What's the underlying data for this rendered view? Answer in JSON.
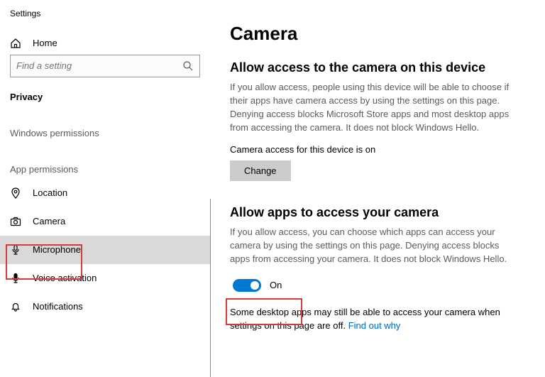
{
  "app_title": "Settings",
  "home_label": "Home",
  "search": {
    "placeholder": "Find a setting"
  },
  "category_label": "Privacy",
  "group_windows": "Windows permissions",
  "group_app": "App permissions",
  "sidebar": {
    "items": [
      {
        "label": "Location"
      },
      {
        "label": "Camera"
      },
      {
        "label": "Microphone"
      },
      {
        "label": "Voice activation"
      },
      {
        "label": "Notifications"
      }
    ]
  },
  "page": {
    "title": "Camera",
    "s1_title": "Allow access to the camera on this device",
    "s1_desc": "If you allow access, people using this device will be able to choose if their apps have camera access by using the settings on this page. Denying access blocks Microsoft Store apps and most desktop apps from accessing the camera. It does not block Windows Hello.",
    "status": "Camera access for this device is on",
    "change_btn": "Change",
    "s2_title": "Allow apps to access your camera",
    "s2_desc": "If you allow access, you can choose which apps can access your camera by using the settings on this page. Denying access blocks apps from accessing your camera. It does not block Windows Hello.",
    "toggle_state": "On",
    "footer_text": "Some desktop apps may still be able to access your camera when settings on this page are off. ",
    "footer_link": "Find out why"
  }
}
